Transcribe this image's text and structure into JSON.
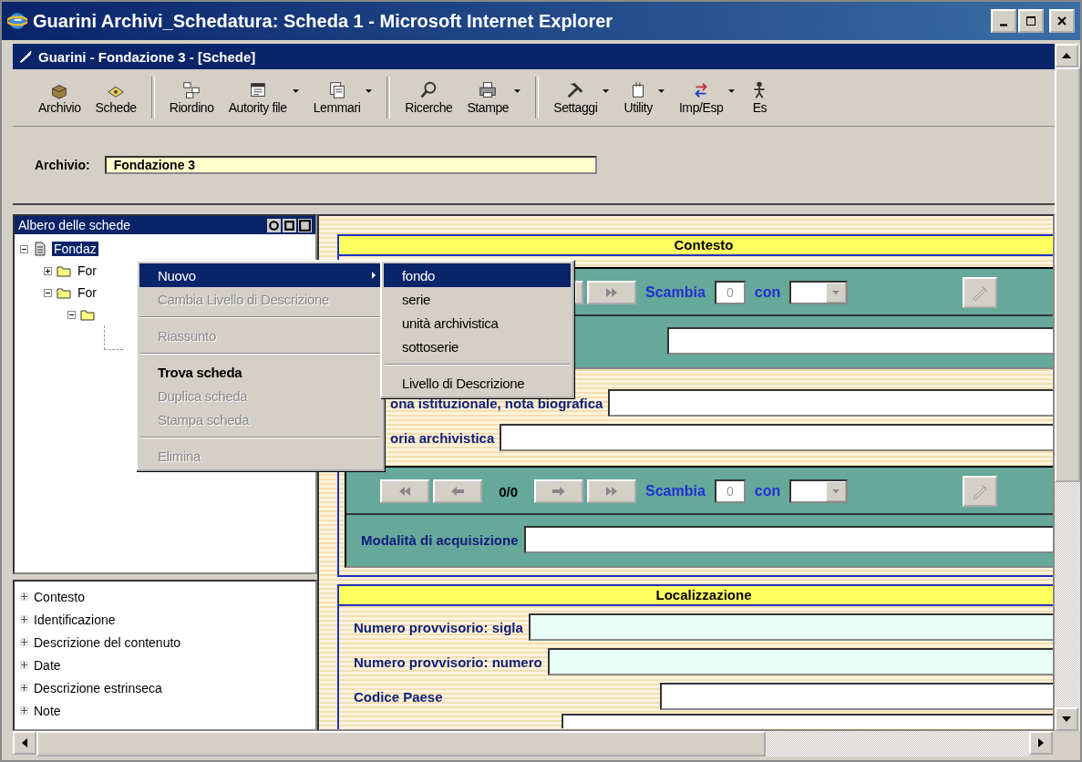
{
  "window": {
    "title": "Guarini Archivi_Schedatura: Scheda 1 - Microsoft Internet Explorer"
  },
  "app_bar": {
    "title": "Guarini - Fondazione 3 - [Schede]"
  },
  "toolbar_groups": [
    [
      {
        "label": "Archivio",
        "dropdown": false
      },
      {
        "label": "Schede",
        "dropdown": false
      }
    ],
    [
      {
        "label": "Riordino",
        "dropdown": false
      },
      {
        "label": "Autority file",
        "dropdown": true
      },
      {
        "label": "Lemmari",
        "dropdown": true
      }
    ],
    [
      {
        "label": "Ricerche",
        "dropdown": false
      },
      {
        "label": "Stampe",
        "dropdown": true
      }
    ],
    [
      {
        "label": "Settaggi",
        "dropdown": true
      },
      {
        "label": "Utility",
        "dropdown": true
      },
      {
        "label": "Imp/Esp",
        "dropdown": true
      },
      {
        "label": "Es",
        "dropdown": false
      }
    ]
  ],
  "archive_field": {
    "label": "Archivio:",
    "value": "Fondazione 3"
  },
  "tree_panel": {
    "title": "Albero delle schede",
    "items": [
      {
        "label": "Fondaz",
        "kind": "document",
        "expanded": true,
        "selected": true,
        "children": [
          {
            "label": "For",
            "kind": "folder",
            "expanded": false,
            "selected": false
          },
          {
            "label": "For",
            "kind": "folder",
            "expanded": true,
            "selected": false,
            "children": [
              {
                "kind": "folder",
                "expanded": true,
                "selected": false
              }
            ]
          }
        ]
      }
    ]
  },
  "sections_list": [
    {
      "label": "Contesto"
    },
    {
      "label": "Identificazione"
    },
    {
      "label": "Descrizione del contenuto"
    },
    {
      "label": "Date"
    },
    {
      "label": "Descrizione estrinseca"
    },
    {
      "label": "Note"
    }
  ],
  "form": {
    "sections": [
      {
        "title": "Contesto",
        "blocks": [
          {
            "kind": "panel",
            "rows": [
              {
                "kind": "nav",
                "partial": true,
                "swap_label": "Scambia",
                "swap_value": "0",
                "with_label": "con"
              },
              {
                "kind": "field",
                "tinted": false
              }
            ]
          },
          {
            "kind": "field",
            "label": "ona istituzionale, nota biografica",
            "tinted": false,
            "covered": true
          },
          {
            "kind": "field",
            "label": "oria archivistica",
            "tinted": false,
            "covered": true
          },
          {
            "kind": "panel",
            "rows": [
              {
                "kind": "nav",
                "partial": false,
                "counter": "0/0",
                "swap_label": "Scambia",
                "swap_value": "0",
                "with_label": "con"
              },
              {
                "kind": "field",
                "label": "Modalità di acquisizione",
                "tinted": false
              }
            ]
          }
        ]
      },
      {
        "title": "Localizzazione",
        "blocks": [
          {
            "kind": "field",
            "label": "Numero provvisorio: sigla",
            "tinted": true
          },
          {
            "kind": "field",
            "label": "Numero provvisorio: numero",
            "tinted": true
          },
          {
            "kind": "field",
            "label": "Codice Paese",
            "tinted": false,
            "wide_label": true
          },
          {
            "kind": "field",
            "tinted": false,
            "cut": true
          }
        ]
      }
    ]
  },
  "context_menu": {
    "items": [
      {
        "kind": "item",
        "label": "Nuovo",
        "submenu": true,
        "disabled": false,
        "selected": true,
        "bold": false
      },
      {
        "kind": "item",
        "label": "Cambia Livello di Descrizione",
        "submenu": false,
        "disabled": true,
        "selected": false,
        "bold": false
      },
      {
        "kind": "separator"
      },
      {
        "kind": "item",
        "label": "Riassunto",
        "submenu": false,
        "disabled": true,
        "selected": false,
        "bold": false
      },
      {
        "kind": "separator"
      },
      {
        "kind": "item",
        "label": "Trova scheda",
        "submenu": false,
        "disabled": false,
        "selected": false,
        "bold": true
      },
      {
        "kind": "item",
        "label": "Duplica scheda",
        "submenu": false,
        "disabled": true,
        "selected": false,
        "bold": false
      },
      {
        "kind": "item",
        "label": "Stampa scheda",
        "submenu": false,
        "disabled": true,
        "selected": false,
        "bold": false
      },
      {
        "kind": "separator"
      },
      {
        "kind": "item",
        "label": "Elimina",
        "submenu": false,
        "disabled": true,
        "selected": false,
        "bold": false
      }
    ]
  },
  "submenu": {
    "items": [
      {
        "kind": "item",
        "label": "fondo",
        "selected": true
      },
      {
        "kind": "item",
        "label": "serie",
        "selected": false
      },
      {
        "kind": "item",
        "label": "unità archivistica",
        "selected": false
      },
      {
        "kind": "item",
        "label": "sottoserie",
        "selected": false
      },
      {
        "kind": "separator"
      },
      {
        "kind": "item",
        "label": "Livello di Descrizione",
        "selected": false
      }
    ]
  }
}
